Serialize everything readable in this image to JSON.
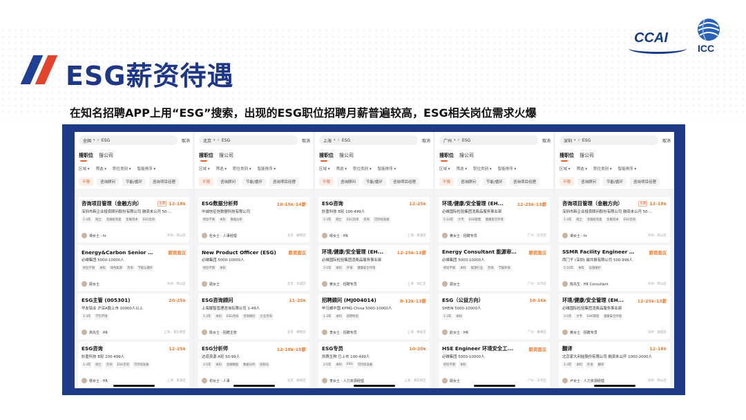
{
  "header": {
    "title": "ESG薪资待遇",
    "subtitle": "在知名招聘APP上用“ESG”搜索，出现的ESG职位招聘月薪普遍较高，ESG相关岗位需求火爆"
  },
  "logos": {
    "ccai": "CCAI",
    "icc": "ICC"
  },
  "colors": {
    "brand_blue": "#1d3686",
    "accent_red": "#e2432d",
    "salary_orange": "#f07a2a"
  },
  "app": {
    "cancel_label": "取消",
    "tab_jobs": "搜职位",
    "tab_company": "搜公司",
    "filters": [
      "区域",
      "筛选",
      "职位类别",
      "智能排序"
    ],
    "chips": [
      "不限",
      "咨询顾问",
      "节能/循环",
      "咨询项目经理"
    ]
  },
  "columns": [
    {
      "city": "全国",
      "query": "ESG",
      "jobs": [
        {
          "title": "咨询项目管理（金融方向）",
          "urgent": "急聘",
          "salary": "12-18k",
          "company": "深圳市新企业投资顾问股份有限公司  融资未公开  50-...",
          "tags": [
            "1-3年",
            "硕士",
            "金融投资类",
            "金融资本",
            "ESG咨询"
          ],
          "recruiter": "谭女士 · hr",
          "location": "深圳 · 南山区"
        },
        {
          "title": "Energy&Carbon Senior Con...",
          "salary": "薪资面议",
          "company": "必维集团  5000-10000人",
          "tags": [
            "经验不限",
            "本科",
            "绿色能源",
            "咨询",
            "节能与循环"
          ],
          "recruiter": "顾女士",
          "location": "深圳 · 南山区"
        },
        {
          "title": "ESG主管 (005301)",
          "salary": "20-25k",
          "company": "华友钴业  沪深A股上市  10000人以上",
          "tags": [
            "1-3年",
            "学历不限"
          ],
          "recruiter": "高先生 · HR",
          "location": "上海 · 浦东新区"
        },
        {
          "title": "ESG咨询",
          "salary": "12-25k",
          "company": "妙盈科技  B轮  100-499人",
          "tags": [
            "1-3年",
            "硕士",
            "咨询",
            "ESG咨询",
            "可持续发展"
          ],
          "recruiter": "缪女士 · HR",
          "location": "上海 · 黄浦区"
        }
      ]
    },
    {
      "city": "北京",
      "query": "ESG",
      "jobs": [
        {
          "title": "ESG数据分析师",
          "salary": "10-15k·14薪",
          "company": "中诚信征信数据科技有限公司",
          "tags": [
            "经验不限",
            "本科",
            "数据分析"
          ],
          "recruiter": "杜女士 · 人事经理",
          "location": "北京 · 朝阳区"
        },
        {
          "title": "New Product Officer (ESG)",
          "salary": "薪资面议",
          "company": "必维集团  5000-10000人",
          "tags": [
            "经验不限",
            "本科"
          ],
          "recruiter": "顾女士",
          "location": "北京 · 东城区"
        },
        {
          "title": "ESG咨询顾问",
          "salary": "11-20k",
          "company": "上海展智管理咨询有限公司  1-49人",
          "tags": [
            "1-3年",
            "本科",
            "ESG咨询",
            "咨询顾问",
            "企业咨询"
          ],
          "recruiter": "陈女士 · 招聘主管",
          "location": "北京 · 朝阳区"
        },
        {
          "title": "ESG分析师",
          "salary": "12-18k·15薪",
          "company": "达道资源  A轮  50-99人",
          "tags": [
            "3-5年",
            "本科",
            "金融数据",
            "数据分析",
            "国际化"
          ],
          "recruiter": "祁女士 · 人事",
          "location": "北京 · 朝阳区"
        }
      ]
    },
    {
      "city": "上海",
      "query": "ESG",
      "jobs": [
        {
          "title": "ESG咨询",
          "salary": "12-25k",
          "company": "妙盈科技  B轮  100-499人",
          "tags": [
            "1-3年",
            "硕士",
            "ESG咨询",
            "咨询",
            "可持续发展"
          ],
          "recruiter": "缪女士 · HR",
          "location": "上海 · 黄浦区"
        },
        {
          "title": "环境/健康/安全管理 (EH...",
          "salary": "12-25k·13薪",
          "company": "必维国际检验集团消费品服务事业部",
          "tags": [
            "3-5年",
            "本科",
            "环保",
            "健康安全环境"
          ],
          "recruiter": "黄女士 · 招聘专员",
          "location": "上海 · 徐汇区"
        },
        {
          "title": "招聘顾问 (MJ004014)",
          "salary": "8-12k·13薪",
          "company": "毕马威中国 KPMG China  5000-10000人",
          "tags": [
            "1-3年",
            "本科",
            "招聘经验"
          ],
          "recruiter": "李女士 · 招聘专员",
          "location": "上海 · 静安区"
        },
        {
          "title": "ESG专员",
          "salary": "10-20k",
          "company": "凯赛生物  已上市  100-499人",
          "tags": [
            "3-5年",
            "本科",
            "ESG",
            "可持续发展"
          ],
          "recruiter": "李女士 · 人力资源经理",
          "location": "上海 · 浦东新区"
        }
      ]
    },
    {
      "city": "广州",
      "query": "ESG",
      "jobs": [
        {
          "title": "环境/健康/安全管理 (EH...",
          "salary": "12-25k·13薪",
          "company": "必维国际检验集团消费品服务事业部",
          "tags": [
            "5-10年",
            "大专",
            "EHS管理",
            "健康安全环境"
          ],
          "recruiter": "黄女士 · 招聘专员",
          "location": "广州 · 天河区"
        },
        {
          "title": "Energy Consultant 能源审...",
          "salary": "薪资面议",
          "company": "必维集团  5000-10000人",
          "tags": [
            "经验不限",
            "本科",
            "能源行业",
            "咨询",
            "节能环保"
          ],
          "recruiter": "顾女士",
          "location": "广州 · 天河区"
        },
        {
          "title": "ESG（公益方向）",
          "salary": "10-16k",
          "company": "SHEIN  5000-10000人",
          "tags": [
            "1-3年",
            "本科"
          ],
          "recruiter": "赵女士 · HR",
          "location": "广州 · 番禺区"
        },
        {
          "title": "HSE Engineer 环境安全工...",
          "salary": "薪资面议",
          "company": "必维集团  5000-10000人",
          "tags": [
            "经验不限",
            "本科"
          ],
          "recruiter": "顾女士",
          "location": "广州 · 天河区"
        }
      ]
    },
    {
      "city": "深圳",
      "query": "ESG",
      "jobs": [
        {
          "title": "咨询项目管理（金融方向）",
          "urgent": "急聘",
          "salary": "12-18k",
          "company": "深圳市新企业投资顾问股份有限公司  融资未公开  50-...",
          "tags": [
            "1-3年",
            "硕士",
            "金融投资类",
            "金融资本",
            "ESG咨询"
          ],
          "recruiter": "谭女士 · hr",
          "location": "深圳 · 南山区"
        },
        {
          "title": "SSMR Facility Engineer 厂...",
          "salary": "薪资面议",
          "company": "西门子 (深圳) 磁共振有限公司  500-999人",
          "tags": [
            "5-10年",
            "本科",
            "设施维护"
          ],
          "recruiter": "陈先生 · HR Consultant",
          "location": "深圳 · 南山区"
        },
        {
          "title": "环境/健康/安全管理 (EH...",
          "salary": "12-25k·13薪",
          "company": "必维国际检验集团消费品服务事业部",
          "tags": [
            "3-5年",
            "大专",
            "EHS管理",
            "健康安全环境"
          ],
          "recruiter": "黄女士 · 招聘专员",
          "location": "深圳 · 福田区"
        },
        {
          "title": "翻译",
          "salary": "12-18k",
          "company": "北京家大利娃股份有限公司  融资未公开  1000-2000人",
          "tags": [
            "1-3年",
            "本科",
            "外语",
            "翻译"
          ],
          "recruiter": "卢女士 · 人力资源经理",
          "location": "深圳 · 南山区"
        }
      ]
    }
  ]
}
